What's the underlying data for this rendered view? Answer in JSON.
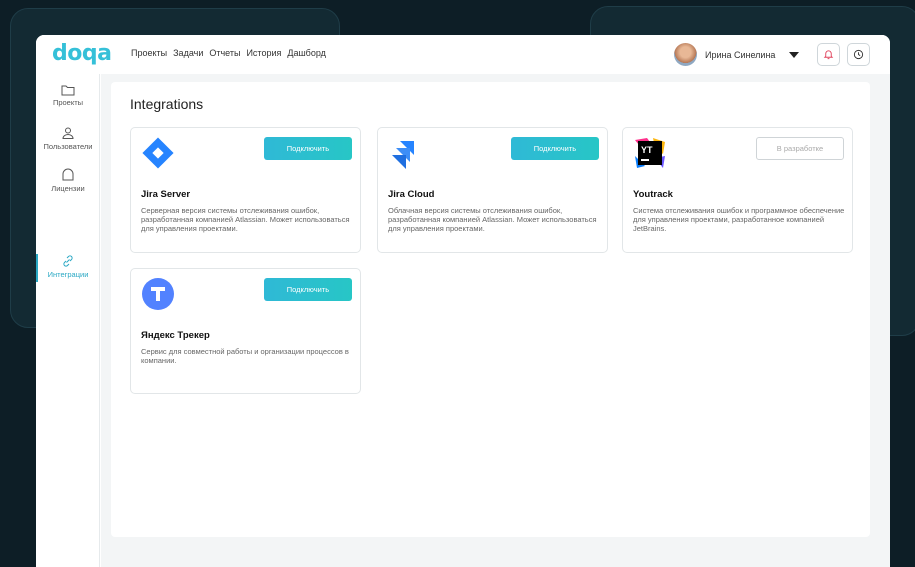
{
  "brand": {
    "logo": "doqa",
    "accent": "#35c0d8"
  },
  "topnav": [
    "Проекты",
    "Задачи",
    "Отчеты",
    "История",
    "Дашборд"
  ],
  "user": {
    "name": "Ирина Синелина"
  },
  "sidebar": {
    "items": [
      {
        "label": "Проекты",
        "icon": "folder-icon"
      },
      {
        "label": "Пользователи",
        "icon": "user-icon"
      },
      {
        "label": "Лицензии",
        "icon": "license-icon"
      },
      {
        "label": "Интеграции",
        "icon": "link-icon",
        "active": true
      }
    ]
  },
  "page": {
    "title": "Integrations"
  },
  "cards": [
    {
      "title": "Jira Server",
      "desc": "Серверная версия системы отслеживания ошибок, разработанная компанией Atlassian. Может использоваться для управления проектами.",
      "button": "Подключить",
      "icon": "jira-server-icon"
    },
    {
      "title": "Jira Cloud",
      "desc": "Облачная версия системы отслеживания ошибок, разработанная компанией Atlassian. Может использоваться для управления проектами.",
      "button": "Подключить",
      "icon": "jira-cloud-icon"
    },
    {
      "title": "Youtrack",
      "desc": "Система отслеживания ошибок и программное обеспечение для управления проектами, разработанное компанией JetBrains.",
      "button": "В разработке",
      "icon": "youtrack-icon",
      "disabled": true
    },
    {
      "title": "Яндекс Трекер",
      "desc": "Сервис для совместной работы и организации процессов в компании.",
      "button": "Подключить",
      "icon": "yandex-tracker-icon"
    }
  ]
}
